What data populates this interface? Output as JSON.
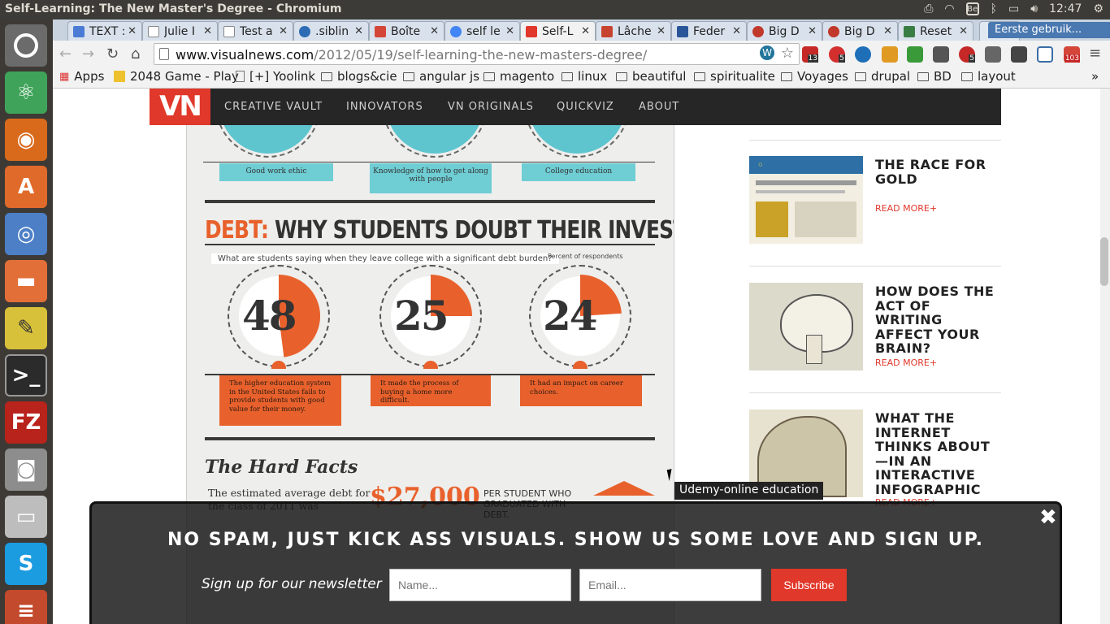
{
  "window": {
    "title": "Self-Learning: The New Master's Degree - Chromium",
    "time": "12:47",
    "keyboard": "Be"
  },
  "tabs": [
    {
      "label": "TEXT :",
      "color": "#4b7bd5"
    },
    {
      "label": "Julie I",
      "color": "#6b8cc4"
    },
    {
      "label": "Test a",
      "color": "#6b8cc4"
    },
    {
      "label": ".siblin",
      "color": "#2d6cb5"
    },
    {
      "label": "Boîte",
      "color": "#d44638"
    },
    {
      "label": "self le",
      "color": "#4285f4"
    },
    {
      "label": "Self-L",
      "color": "#e0382a"
    },
    {
      "label": "Lâche",
      "color": "#c8432f"
    },
    {
      "label": "Feder",
      "color": "#2a5599"
    },
    {
      "label": "Big D",
      "color": "#c0392b"
    },
    {
      "label": "Big D",
      "color": "#c0392b"
    },
    {
      "label": "Reset",
      "color": "#3a7d44"
    }
  ],
  "profile": "Eerste gebruik...",
  "address": {
    "host": "www.visualnews.com",
    "path": "/2012/05/19/self-learning-the-new-masters-degree/"
  },
  "extensions": {
    "badge1": "13",
    "badge2": "5",
    "abp": "5",
    "mail": "103"
  },
  "bookmarks": [
    "Apps",
    "2048 Game - Play",
    "[+] Yoolink",
    "blogs&cie",
    "angular js",
    "magento",
    "linux",
    "beautiful",
    "spiritualite",
    "Voyages",
    "drupal",
    "BD",
    "layout"
  ],
  "site": {
    "logo": "VN",
    "nav": [
      "CREATIVE VAULT",
      "INNOVATORS",
      "VN ORIGINALS",
      "QUICKVIZ",
      "ABOUT"
    ]
  },
  "infographic": {
    "top_labels": [
      "Good work ethic",
      "Knowledge of how to get along with people",
      "College education"
    ],
    "debt_prefix": "DEBT:",
    "debt_title": "WHY STUDENTS DOUBT THEIR INVESTMENT",
    "question": "What are students saying when they leave college with a significant debt burden?",
    "percent_label": "Percent of respondents",
    "stats": [
      {
        "value": "48",
        "unit": "%",
        "text": "The higher education system in the United States fails to provide students with good value for their money."
      },
      {
        "value": "25",
        "unit": "%",
        "text": "It made the process of buying a home more difficult."
      },
      {
        "value": "24",
        "unit": "%",
        "text": "It had an impact on career choices."
      }
    ],
    "hard_facts": "The Hard Facts",
    "estimate": "The estimated average debt for the class of 2011 was",
    "amount": "$27,000",
    "per_student": "PER STUDENT WHO GRADUATED WITH DEBT."
  },
  "sidebar": [
    {
      "title": "THE RACE FOR GOLD",
      "more": "READ MORE+"
    },
    {
      "title": "HOW DOES THE ACT OF WRITING AFFECT YOUR BRAIN?",
      "more": "READ MORE+"
    },
    {
      "title": "WHAT THE INTERNET THINKS ABOUT—IN AN INTERACTIVE INFOGRAPHIC",
      "more": "READ MORE+"
    }
  ],
  "tooltip": "Udemy-online education",
  "newsletter": {
    "headline": "NO SPAM, JUST KICK ASS VISUALS. SHOW US SOME LOVE AND SIGN UP.",
    "label": "Sign up for our newsletter",
    "name_placeholder": "Name...",
    "email_placeholder": "Email...",
    "subscribe": "Subscribe",
    "close": "✖"
  }
}
